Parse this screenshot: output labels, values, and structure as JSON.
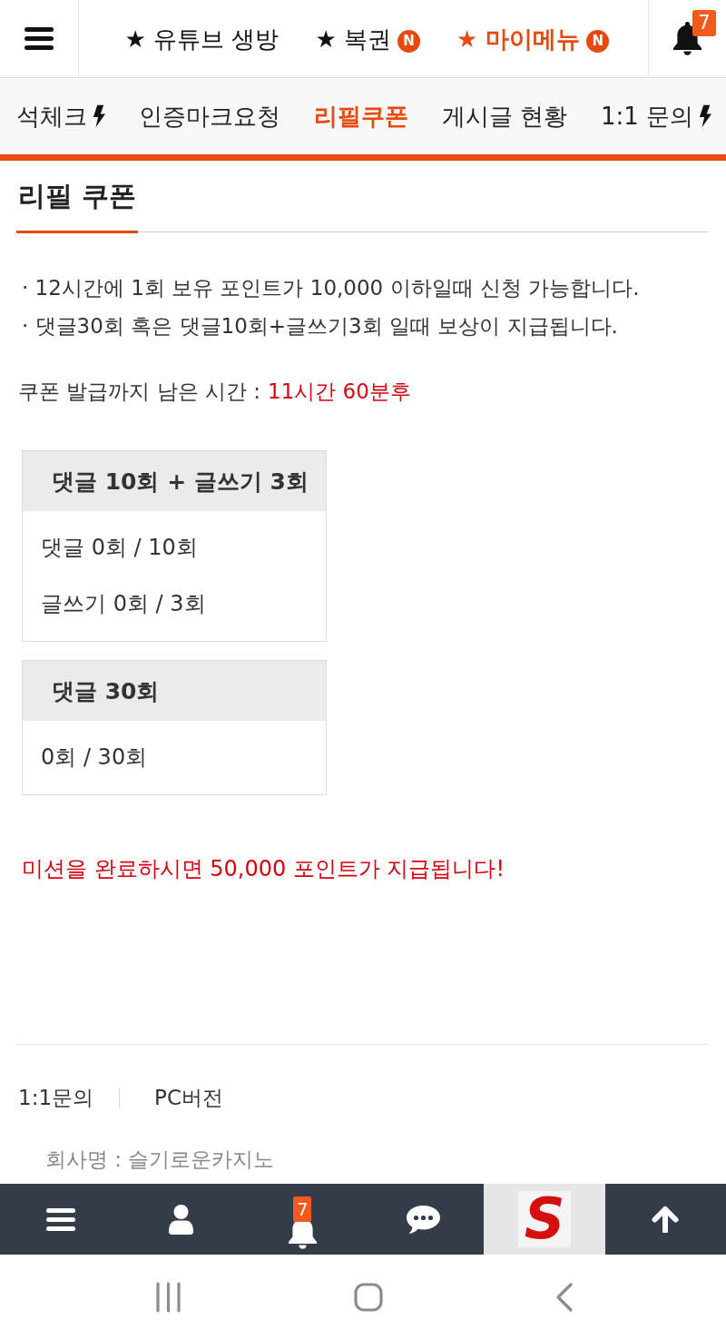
{
  "top_bar": {
    "nav": [
      {
        "label": "★ 유튜브 생방",
        "highlighted": false
      },
      {
        "label": "★ 복권",
        "highlighted": false,
        "badge": "N"
      },
      {
        "label": "★ 마이메뉴",
        "highlighted": true,
        "badge": "N"
      }
    ],
    "notification_count": "7"
  },
  "tabs": [
    {
      "label": "석체크",
      "kind": "flash",
      "selected": false
    },
    {
      "label": "인증마크요청",
      "kind": "plain",
      "selected": false
    },
    {
      "label": "리필쿠폰",
      "kind": "plain",
      "selected": true
    },
    {
      "label": "게시글 현황",
      "kind": "plain",
      "selected": false
    },
    {
      "label": "1:1 문의",
      "kind": "flash",
      "selected": false
    }
  ],
  "page": {
    "title": "리필 쿠폰",
    "notes": [
      "· 12시간에 1회 보유 포인트가 10,000 이하일때 신청 가능합니다.",
      "· 댓글30회 혹은 댓글10회+글쓰기3회 일때 보상이 지급됩니다."
    ],
    "countdown": {
      "label": "쿠폰 발급까지 남은 시간 :",
      "value": "11시간 60분후"
    },
    "missions": [
      {
        "title": "댓글 10회 + 글쓰기 3회",
        "rows": [
          "댓글 0회 / 10회",
          "글쓰기 0회 / 3회"
        ]
      },
      {
        "title": "댓글 30회",
        "rows": [
          "0회 / 30회"
        ]
      }
    ],
    "reward_message": "미션을 완료하시면 50,000 포인트가 지급됩니다!"
  },
  "footer": {
    "links": [
      "1:1문의",
      "PC버전"
    ],
    "company": "회사명 : 슬기로운카지노"
  },
  "bottom_nav": [
    {
      "kind": "menu"
    },
    {
      "kind": "profile"
    },
    {
      "kind": "alerts",
      "badge": "7"
    },
    {
      "kind": "chat"
    },
    {
      "kind": "logo",
      "label": "S"
    },
    {
      "kind": "top"
    }
  ]
}
